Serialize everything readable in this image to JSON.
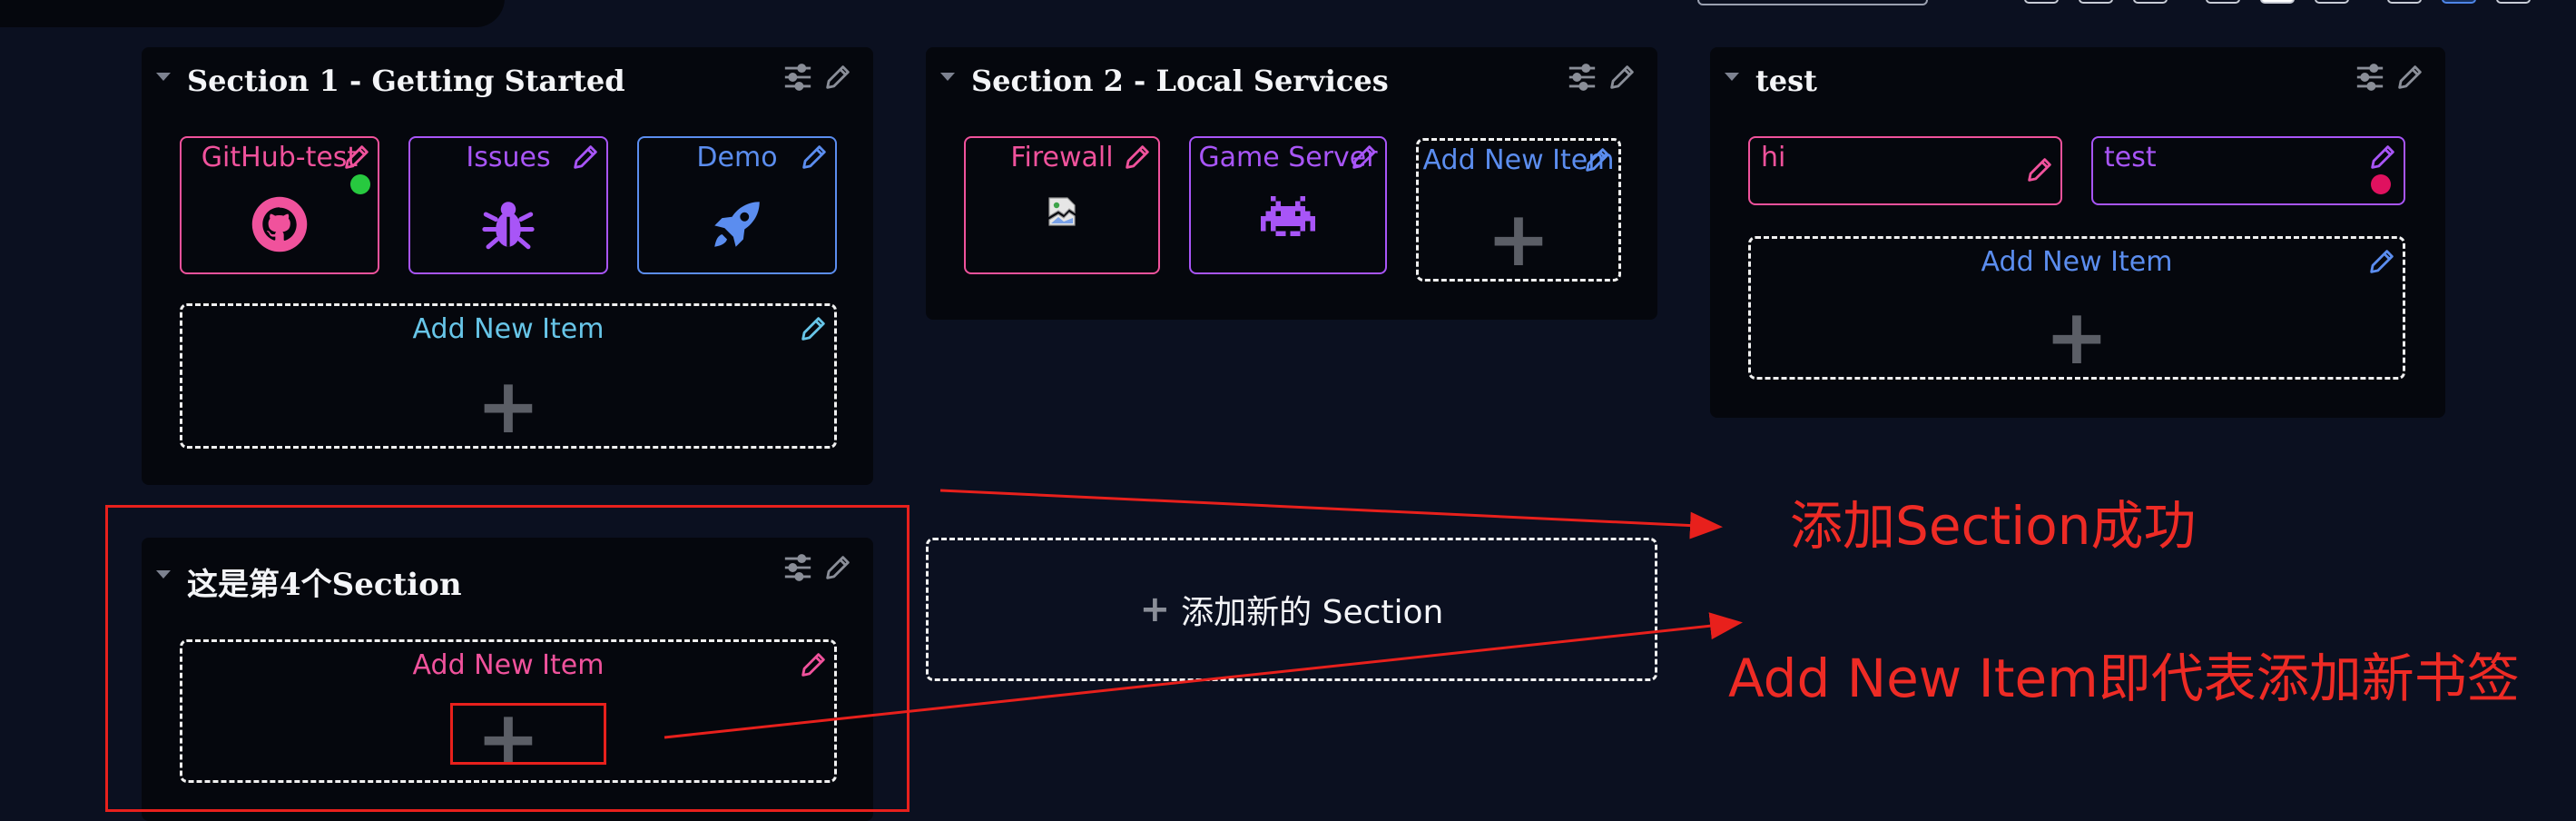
{
  "colors": {
    "background": "#0b1020",
    "section_bg": "#05070d",
    "pink": "#f0529c",
    "purple": "#a855f7",
    "blue": "#5b8def",
    "cyan": "#67c5e8",
    "red_annotation": "#e8201c",
    "status_green": "#27c93f",
    "status_red": "#e0115f"
  },
  "sections": [
    {
      "title": "Section 1 - Getting Started",
      "items": [
        {
          "label": "GitHub-test",
          "icon": "github-icon",
          "status": "online"
        },
        {
          "label": "Issues",
          "icon": "bug-icon"
        },
        {
          "label": "Demo",
          "icon": "rocket-icon"
        }
      ],
      "add_label": "Add New Item"
    },
    {
      "title": "Section 2 - Local Services",
      "items": [
        {
          "label": "Firewall",
          "icon": "broken-image-icon"
        },
        {
          "label": "Game Server",
          "icon": "space-invader-icon"
        }
      ],
      "add_label": "Add New Item"
    },
    {
      "title": "test",
      "items": [
        {
          "label": "hi"
        },
        {
          "label": "test",
          "status": "offline"
        }
      ],
      "add_label": "Add New Item"
    },
    {
      "title": "这是第4个Section",
      "items": [],
      "add_label": "Add New Item"
    }
  ],
  "add_section_label": "添加新的 Section",
  "annotations": {
    "section_added": "添加Section成功",
    "add_item_meaning": "Add New Item即代表添加新书签"
  }
}
